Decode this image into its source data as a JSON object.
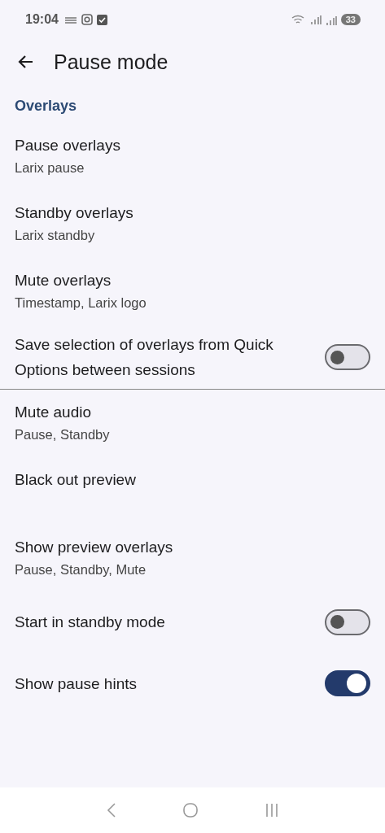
{
  "status_bar": {
    "time": "19:04",
    "battery": "33"
  },
  "app_bar": {
    "title": "Pause mode"
  },
  "sections": [
    {
      "header": "Overlays",
      "items": [
        {
          "kind": "text",
          "title": "Pause overlays",
          "subtitle": "Larix pause"
        },
        {
          "kind": "text",
          "title": "Standby overlays",
          "subtitle": "Larix standby"
        },
        {
          "kind": "text",
          "title": "Mute overlays",
          "subtitle": "Timestamp, Larix logo"
        },
        {
          "kind": "switch",
          "title": "Save selection of overlays from Quick Options between sessions",
          "on": false
        }
      ]
    },
    {
      "items": [
        {
          "kind": "text",
          "title": "Mute audio",
          "subtitle": "Pause, Standby"
        },
        {
          "kind": "text",
          "title": "Black out preview"
        },
        {
          "kind": "text",
          "title": "Show preview overlays",
          "subtitle": "Pause, Standby, Mute"
        },
        {
          "kind": "switch",
          "title": "Start in standby mode",
          "on": false
        },
        {
          "kind": "switch",
          "title": "Show pause hints",
          "on": true
        }
      ]
    }
  ]
}
